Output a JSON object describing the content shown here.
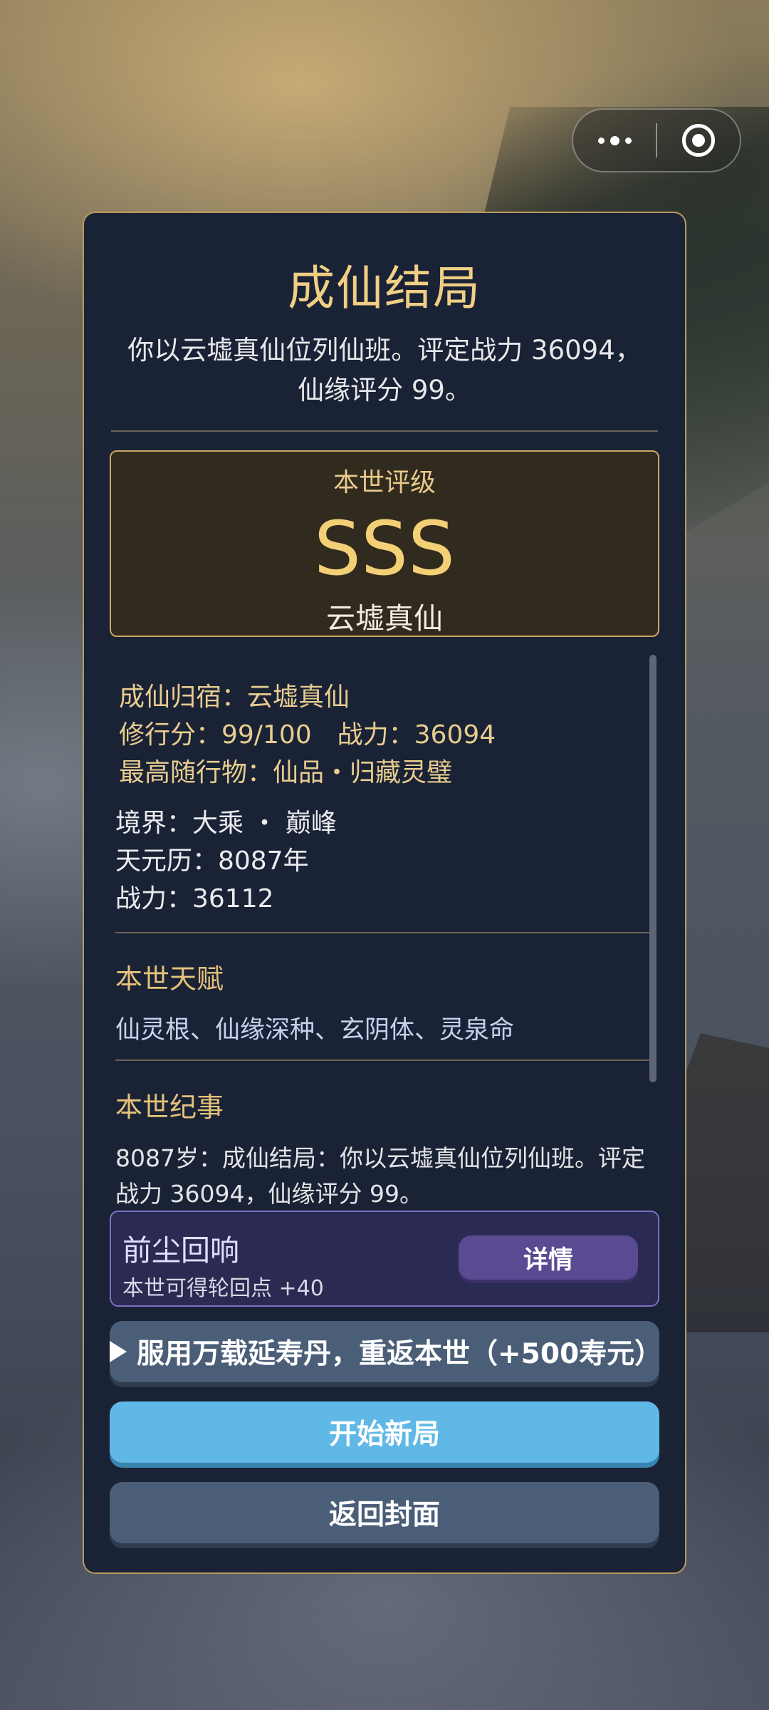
{
  "capsule": {
    "more_icon": "more-dots-icon",
    "close_icon": "target-circle-icon"
  },
  "panel": {
    "title": "成仙结局",
    "summary_line1": "你以云墟真仙位列仙班。评定战力 36094，",
    "summary_line2": "仙缘评分 99。",
    "grade": {
      "label": "本世评级",
      "value": "SSS",
      "subtitle": "云墟真仙"
    },
    "stats": {
      "destination": "成仙归宿：云墟真仙",
      "score_power": "修行分：99/100　战力：36094",
      "artifact": "最高随行物：仙品・归藏灵璧",
      "realm": "境界：大乘 ・ 巅峰",
      "calendar": "天元历：8087年",
      "power": "战力：36112"
    },
    "talents": {
      "title": "本世天赋",
      "text": "仙灵根、仙缘深种、玄阴体、灵泉命"
    },
    "chronicle": {
      "title": "本世纪事",
      "text": "8087岁：成仙结局：你以云墟真仙位列仙班。评定战力 36094，仙缘评分 99。"
    },
    "echo": {
      "title": "前尘回响",
      "subtitle": "本世可得轮回点 +40",
      "detail_label": "详情"
    },
    "buttons": {
      "revive": "服用万载延寿丹，重返本世（+500寿元）",
      "new_game": "开始新局",
      "back_cover": "返回封面"
    }
  },
  "colors": {
    "panel_bg": "#1a2236",
    "gold": "#f0cf85",
    "primary_button": "#5fb8e6",
    "secondary_button": "#4b5e78",
    "echo_accent": "#7d70c2"
  }
}
